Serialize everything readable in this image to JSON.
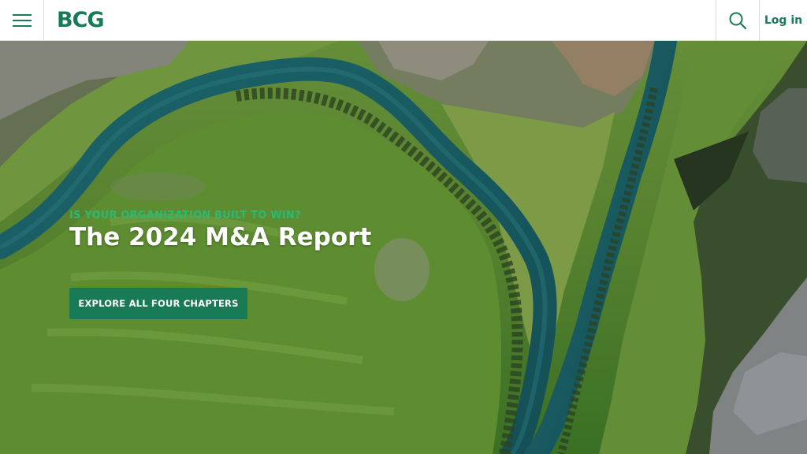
{
  "header": {
    "logo_text": "BCG",
    "login_label": "Log in",
    "icons": [
      "hamburger-menu-icon",
      "search-icon"
    ]
  },
  "hero": {
    "eyebrow": "IS YOUR ORGANIZATION BUILT TO WIN?",
    "headline": "The 2024 M&A Report",
    "cta_label": "EXPLORE ALL FOUR CHAPTERS"
  },
  "colors": {
    "brand_green": "#177b57",
    "accent_green": "#29ba74",
    "cta_bg": "#197a56"
  }
}
